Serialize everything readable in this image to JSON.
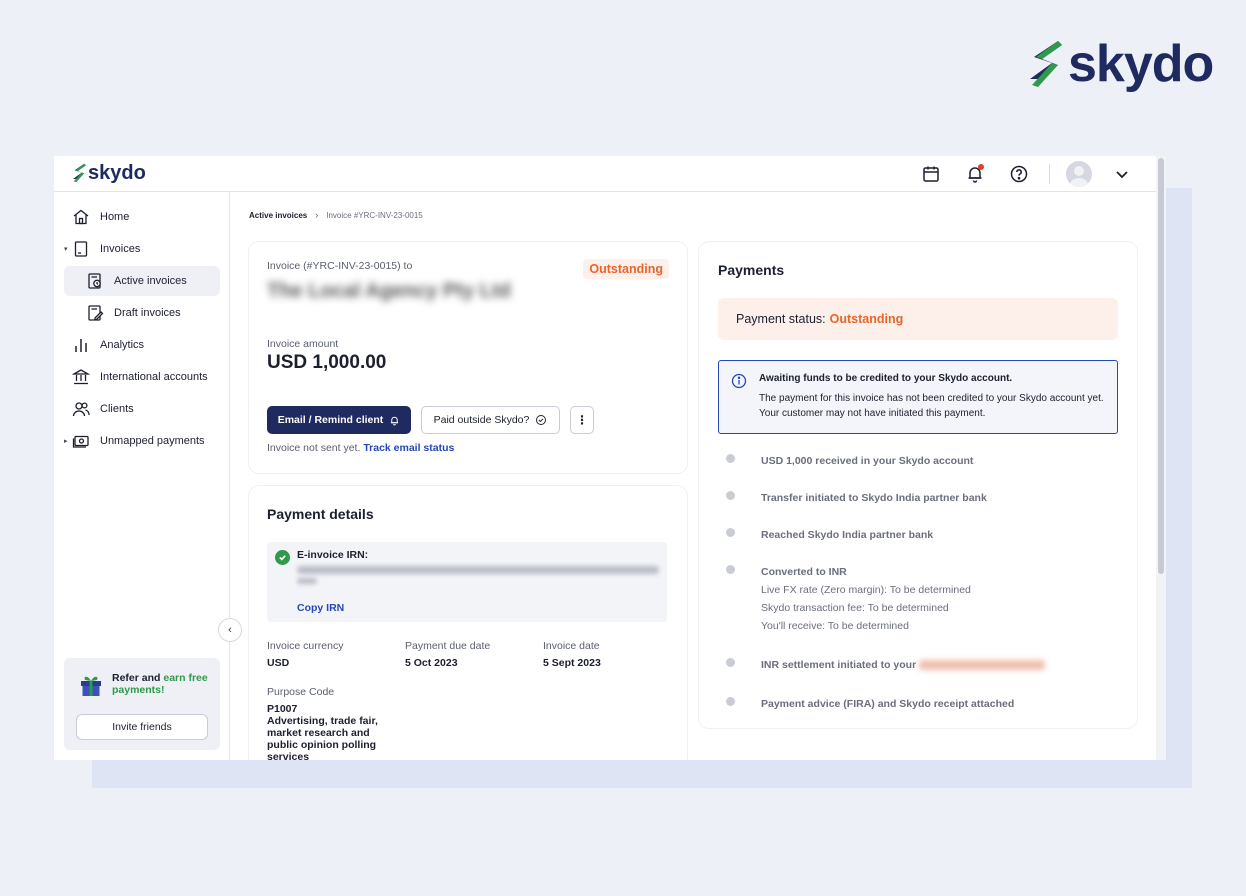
{
  "brand": {
    "word": "skydo"
  },
  "app": {
    "logo_word": "skydo"
  },
  "sidebar": {
    "items": [
      {
        "label": "Home"
      },
      {
        "label": "Invoices"
      },
      {
        "label": "Active invoices"
      },
      {
        "label": "Draft invoices"
      },
      {
        "label": "Analytics"
      },
      {
        "label": "International accounts"
      },
      {
        "label": "Clients"
      },
      {
        "label": "Unmapped payments"
      }
    ],
    "refer": {
      "text_a": "Refer and ",
      "text_b": "earn free payments!",
      "button": "Invite friends"
    }
  },
  "breadcrumb": {
    "parent": "Active invoices",
    "current": "Invoice #YRC-INV-23-0015"
  },
  "invoice": {
    "to_label": "Invoice (#YRC-INV-23-0015) to",
    "status": "Outstanding",
    "client_name": "The Local Agency Pty Ltd",
    "amount_label": "Invoice amount",
    "amount": "USD 1,000.00",
    "remind_button": "Email / Remind client",
    "paid_outside_button": "Paid outside Skydo?",
    "more_button": "⋮",
    "not_sent": "Invoice not sent yet.",
    "track_link": "Track email status"
  },
  "payment_details": {
    "title": "Payment details",
    "irn_label": "E-invoice IRN:",
    "copy_irn": "Copy IRN",
    "currency_label": "Invoice currency",
    "currency": "USD",
    "due_label": "Payment due date",
    "due": "5 Oct 2023",
    "date_label": "Invoice date",
    "date": "5 Sept 2023",
    "purpose_label": "Purpose Code",
    "purpose_code": "P1007",
    "purpose_desc": "Advertising, trade fair, market research and public opinion polling services"
  },
  "payments": {
    "title": "Payments",
    "status_label": "Payment status:",
    "status_value": "Outstanding",
    "info_title": "Awaiting funds to be credited to your Skydo account.",
    "info_body": "The payment for this invoice has not been credited to your Skydo account yet. Your customer may not have initiated this payment.",
    "steps": [
      "USD 1,000 received in your Skydo account",
      "Transfer initiated to Skydo India partner bank",
      "Reached Skydo India partner bank",
      "Converted to INR",
      "Live FX rate (Zero margin): To be determined",
      "Skydo transaction fee: To be determined",
      "You'll receive: To be determined",
      "INR settlement initiated to your",
      "Payment advice (FIRA) and Skydo receipt attached"
    ]
  },
  "colors": {
    "navy": "#1f2a60",
    "outstanding": "#e8652a",
    "link": "#2547b8",
    "success": "#2e9a4a"
  }
}
